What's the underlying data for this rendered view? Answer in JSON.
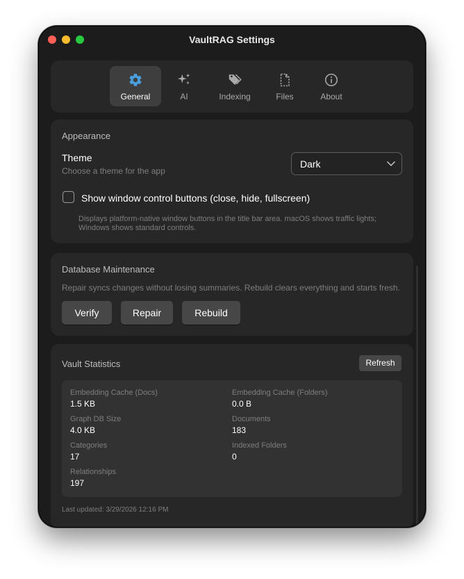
{
  "window": {
    "title": "VaultRAG Settings"
  },
  "tabs": [
    {
      "label": "General",
      "icon": "gear-icon",
      "active": true
    },
    {
      "label": "AI",
      "icon": "sparkles-icon",
      "active": false
    },
    {
      "label": "Indexing",
      "icon": "tags-icon",
      "active": false
    },
    {
      "label": "Files",
      "icon": "file-icon",
      "active": false
    },
    {
      "label": "About",
      "icon": "info-icon",
      "active": false
    }
  ],
  "appearance": {
    "title": "Appearance",
    "theme_label": "Theme",
    "theme_desc": "Choose a theme for the app",
    "theme_value": "Dark",
    "checkbox_label": "Show window control buttons (close, hide, fullscreen)",
    "checkbox_checked": false,
    "checkbox_help": "Displays platform-native window buttons in the title bar area. macOS shows traffic lights; Windows shows standard controls."
  },
  "database": {
    "title": "Database Maintenance",
    "desc": "Repair syncs changes without losing summaries. Rebuild clears everything and starts fresh.",
    "buttons": [
      "Verify",
      "Repair",
      "Rebuild"
    ]
  },
  "stats": {
    "title": "Vault Statistics",
    "refresh_label": "Refresh",
    "items": [
      {
        "label": "Embedding Cache (Docs)",
        "value": "1.5 KB"
      },
      {
        "label": "Embedding Cache (Folders)",
        "value": "0.0 B"
      },
      {
        "label": "Graph DB Size",
        "value": "4.0 KB"
      },
      {
        "label": "Documents",
        "value": "183"
      },
      {
        "label": "Categories",
        "value": "17"
      },
      {
        "label": "Indexed Folders",
        "value": "0"
      },
      {
        "label": "Relationships",
        "value": "197"
      }
    ],
    "last_updated": "Last updated: 3/29/2026 12:16 PM"
  },
  "colors": {
    "accent": "#4a9fe0",
    "window_bg": "#1c1c1c",
    "card_bg": "#272727",
    "traffic_close": "#fe5f57",
    "traffic_min": "#febc2e",
    "traffic_max": "#28c840"
  }
}
